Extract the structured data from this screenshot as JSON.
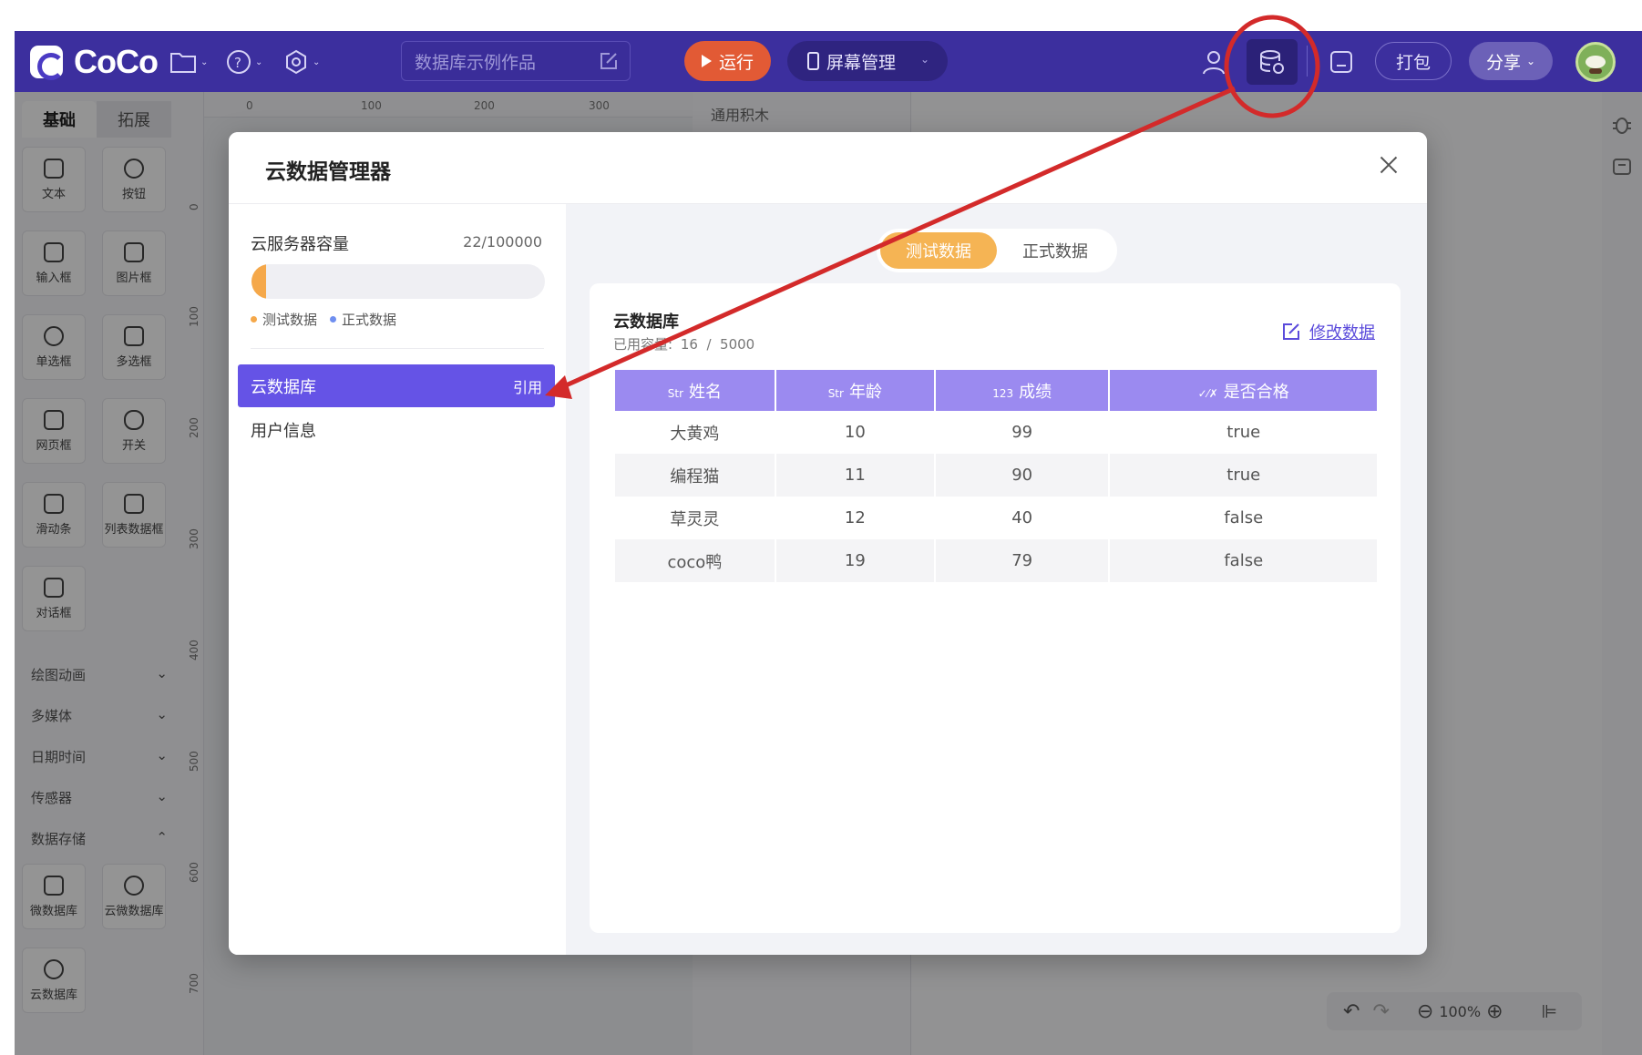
{
  "app": {
    "logo": "CoCo",
    "project_name": "数据库示例作品",
    "run_label": "运行",
    "screen_label": "屏幕管理",
    "pack_label": "打包",
    "share_label": "分享"
  },
  "left_panel": {
    "tabs": [
      "基础",
      "拓展"
    ],
    "components": [
      {
        "label": "文本"
      },
      {
        "label": "按钮"
      },
      {
        "label": "输入框"
      },
      {
        "label": "图片框"
      },
      {
        "label": "单选框"
      },
      {
        "label": "多选框"
      },
      {
        "label": "网页框"
      },
      {
        "label": "开关"
      },
      {
        "label": "滑动条"
      },
      {
        "label": "列表数据框"
      },
      {
        "label": "对话框"
      }
    ],
    "categories": [
      {
        "label": "绘图动画",
        "caret": "⌄"
      },
      {
        "label": "多媒体",
        "caret": "⌄"
      },
      {
        "label": "日期时间",
        "caret": "⌄"
      },
      {
        "label": "传感器",
        "caret": "⌄"
      },
      {
        "label": "数据存储",
        "caret": "⌃"
      }
    ],
    "storage_components": [
      {
        "label": "微数据库"
      },
      {
        "label": "云微数据库"
      },
      {
        "label": "云数据库"
      }
    ]
  },
  "canvas": {
    "ruler_h": [
      "0",
      "100",
      "200",
      "300"
    ],
    "ruler_v": [
      "0",
      "100",
      "200",
      "300",
      "400",
      "500",
      "600",
      "700"
    ],
    "blocks_title": "通用积木",
    "zoom": "100%"
  },
  "modal": {
    "title": "云数据管理器",
    "capacity_label": "云服务器容量",
    "capacity_value": "22/100000",
    "capacity_fraction": 0.00022,
    "legend": [
      "测试数据",
      "正式数据"
    ],
    "legend_colors": [
      "#f5a84a",
      "#6f8ff0"
    ],
    "databases": [
      {
        "name": "云数据库",
        "ref": "引用",
        "active": true
      },
      {
        "name": "用户信息",
        "ref": "",
        "active": false
      }
    ],
    "tabs": [
      "测试数据",
      "正式数据"
    ],
    "active_tab": 0,
    "card": {
      "title": "云数据库",
      "usage_label": "已用容量:",
      "usage_value": "16  /  5000",
      "edit_label": "修改数据"
    },
    "table": {
      "columns": [
        {
          "type": "Str",
          "name": "姓名"
        },
        {
          "type": "Str",
          "name": "年龄"
        },
        {
          "type": "123",
          "name": "成绩"
        },
        {
          "type": "✓⁄✗",
          "name": "是否合格"
        }
      ],
      "rows": [
        [
          "大黄鸡",
          "10",
          "99",
          "true"
        ],
        [
          "编程猫",
          "11",
          "90",
          "true"
        ],
        [
          "草灵灵",
          "12",
          "40",
          "false"
        ],
        [
          "coco鸭",
          "19",
          "79",
          "false"
        ]
      ]
    }
  },
  "colors": {
    "topbar": "#3c2f9e",
    "accent": "#6553e6",
    "orange": "#f5b454",
    "header": "#9b8af0",
    "annotation": "#d32a2a"
  }
}
